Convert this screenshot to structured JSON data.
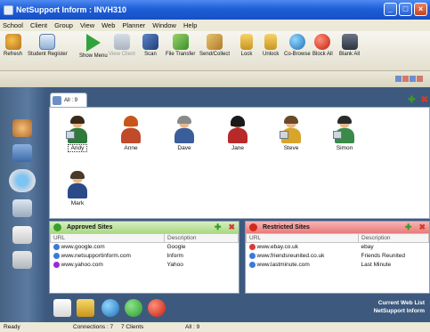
{
  "window": {
    "title": "NetSupport Inform : INVH310"
  },
  "menu": [
    "School",
    "Client",
    "Group",
    "View",
    "Web",
    "Planner",
    "Window",
    "Help"
  ],
  "toolbar": [
    {
      "label": "Refresh",
      "icon": "refresh-icon",
      "disabled": false
    },
    {
      "label": "Student Register",
      "icon": "register-icon",
      "disabled": false
    },
    {
      "label": "Show Menu",
      "icon": "show-menu-icon",
      "disabled": false
    },
    {
      "label": "View Client",
      "icon": "view-client-icon",
      "disabled": true
    },
    {
      "label": "Scan",
      "icon": "scan-icon",
      "disabled": false
    },
    {
      "label": "File Transfer",
      "icon": "file-transfer-icon",
      "disabled": false
    },
    {
      "label": "Send/Collect",
      "icon": "send-collect-icon",
      "disabled": false
    },
    {
      "label": "Lock",
      "icon": "lock-icon",
      "disabled": false
    },
    {
      "label": "Unlock",
      "icon": "unlock-icon",
      "disabled": false
    },
    {
      "label": "Co-Browse",
      "icon": "co-browse-icon",
      "disabled": false
    },
    {
      "label": "Block All",
      "icon": "block-all-icon",
      "disabled": false
    },
    {
      "label": "Blank All",
      "icon": "blank-all-icon",
      "disabled": false
    }
  ],
  "group_tab": {
    "label": "All : 9"
  },
  "clients": [
    {
      "name": "Andy"
    },
    {
      "name": "Anne"
    },
    {
      "name": "Dave"
    },
    {
      "name": "Jane"
    },
    {
      "name": "Steve"
    },
    {
      "name": "Simon"
    },
    {
      "name": "Mark"
    }
  ],
  "approved": {
    "title": "Approved Sites",
    "columns": [
      "URL",
      "Description"
    ],
    "rows": [
      {
        "url": "www.google.com",
        "desc": "Google"
      },
      {
        "url": "www.netsupportinform.com",
        "desc": "Inform"
      },
      {
        "url": "www.yahoo.com",
        "desc": "Yahoo"
      }
    ]
  },
  "restricted": {
    "title": "Restricted Sites",
    "columns": [
      "URL",
      "Description"
    ],
    "rows": [
      {
        "url": "www.ebay.co.uk",
        "desc": "ebay"
      },
      {
        "url": "www.friendsreunited.co.uk",
        "desc": "Friends Reunited"
      },
      {
        "url": "www.lastminute.com",
        "desc": "Last Minute"
      }
    ]
  },
  "webinfo": {
    "line1": "Current Web List",
    "line2": "NetSupport Inform"
  },
  "status": {
    "ready": "Ready",
    "connections": "Connections : 7",
    "clients": "7 Clients",
    "all": "All : 9"
  },
  "colors": {
    "title_blue": "#1f5fd8",
    "sidebar": "#466383",
    "approved_head": "#c8e6a8",
    "restricted_head": "#f08c8c"
  }
}
